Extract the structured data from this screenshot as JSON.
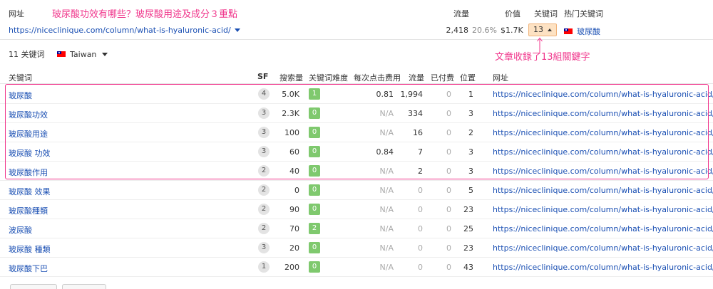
{
  "header": {
    "col_url": "网址",
    "col_traffic": "流量",
    "col_value": "价值",
    "col_keywords": "关键词",
    "col_top_keyword": "热门关键词",
    "url": "https://niceclinique.com/column/what-is-hyaluronic-acid/",
    "traffic": "2,418",
    "traffic_pct": "20.6%",
    "value": "$1.7K",
    "keywords_count": "13",
    "top_keyword": "玻尿酸"
  },
  "annotations": {
    "title": "玻尿酸功效有哪些？玻尿酸用途及成分３重點",
    "keywords_note": "文章收錄了13組關鍵字",
    "accent_color": "#f0358b"
  },
  "filter": {
    "count_label": "11 关键词",
    "country": "Taiwan"
  },
  "columns": [
    "关键词",
    "SF",
    "搜索量",
    "关键词难度",
    "每次点击费用",
    "流量",
    "已付费",
    "位置",
    "网址"
  ],
  "rows": [
    {
      "keyword": "玻尿酸",
      "sf": "4",
      "volume": "5.0K",
      "kd": "1",
      "cpc": "0.81",
      "traffic": "1,994",
      "paid": "0",
      "position": "1",
      "url": "https://niceclinique.com/column/what-is-hyaluronic-acid/"
    },
    {
      "keyword": "玻尿酸功效",
      "sf": "3",
      "volume": "2.3K",
      "kd": "0",
      "cpc": "N/A",
      "traffic": "334",
      "paid": "0",
      "position": "3",
      "url": "https://niceclinique.com/column/what-is-hyaluronic-acid/"
    },
    {
      "keyword": "玻尿酸用途",
      "sf": "3",
      "volume": "100",
      "kd": "0",
      "cpc": "N/A",
      "traffic": "16",
      "paid": "0",
      "position": "2",
      "url": "https://niceclinique.com/column/what-is-hyaluronic-acid/"
    },
    {
      "keyword": "玻尿酸 功效",
      "sf": "3",
      "volume": "60",
      "kd": "0",
      "cpc": "0.84",
      "traffic": "7",
      "paid": "0",
      "position": "3",
      "url": "https://niceclinique.com/column/what-is-hyaluronic-acid/"
    },
    {
      "keyword": "玻尿酸作用",
      "sf": "2",
      "volume": "40",
      "kd": "0",
      "cpc": "N/A",
      "traffic": "2",
      "paid": "0",
      "position": "3",
      "url": "https://niceclinique.com/column/what-is-hyaluronic-acid/"
    },
    {
      "keyword": "玻尿酸 效果",
      "sf": "2",
      "volume": "0",
      "kd": "0",
      "cpc": "N/A",
      "traffic": "0",
      "paid": "0",
      "position": "5",
      "url": "https://niceclinique.com/column/what-is-hyaluronic-acid/"
    },
    {
      "keyword": "玻尿酸種類",
      "sf": "2",
      "volume": "90",
      "kd": "0",
      "cpc": "N/A",
      "traffic": "0",
      "paid": "0",
      "position": "23",
      "url": "https://niceclinique.com/column/what-is-hyaluronic-acid/"
    },
    {
      "keyword": "波尿酸",
      "sf": "2",
      "volume": "70",
      "kd": "2",
      "cpc": "N/A",
      "traffic": "0",
      "paid": "0",
      "position": "25",
      "url": "https://niceclinique.com/column/what-is-hyaluronic-acid/"
    },
    {
      "keyword": "玻尿酸 種類",
      "sf": "3",
      "volume": "20",
      "kd": "0",
      "cpc": "N/A",
      "traffic": "0",
      "paid": "0",
      "position": "23",
      "url": "https://niceclinique.com/column/what-is-hyaluronic-acid/"
    },
    {
      "keyword": "玻尿酸下巴",
      "sf": "1",
      "volume": "200",
      "kd": "0",
      "cpc": "N/A",
      "traffic": "0",
      "paid": "0",
      "position": "43",
      "url": "https://niceclinique.com/column/what-is-hyaluronic-acid/"
    }
  ]
}
